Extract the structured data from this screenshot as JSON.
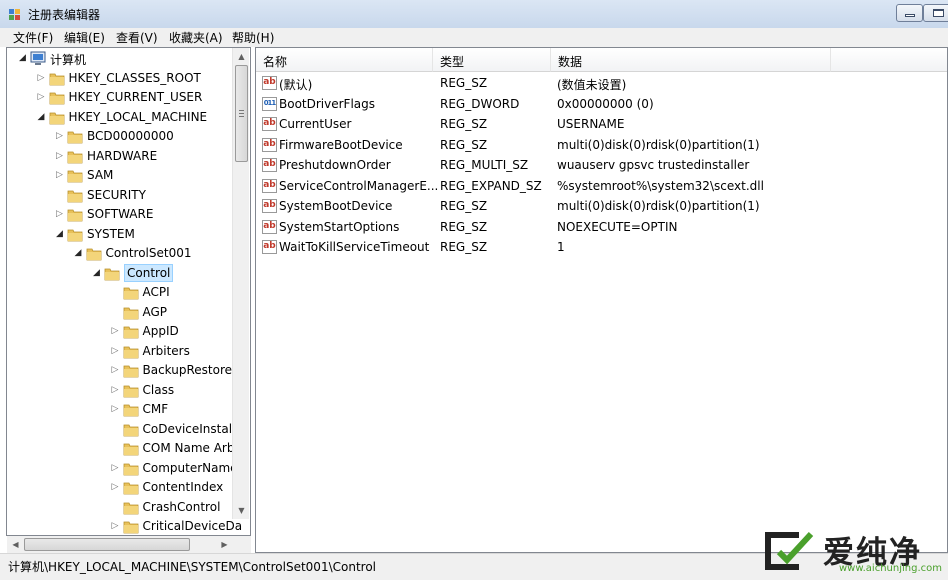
{
  "window": {
    "title": "注册表编辑器"
  },
  "menu": [
    "文件(F)",
    "编辑(E)",
    "查看(V)",
    "收藏夹(A)",
    "帮助(H)"
  ],
  "tree": [
    {
      "label": "计算机",
      "level": 0,
      "state": "open",
      "icon": "computer-icon"
    },
    {
      "label": "HKEY_CLASSES_ROOT",
      "level": 1,
      "state": "closed"
    },
    {
      "label": "HKEY_CURRENT_USER",
      "level": 1,
      "state": "closed"
    },
    {
      "label": "HKEY_LOCAL_MACHINE",
      "level": 1,
      "state": "open"
    },
    {
      "label": "BCD00000000",
      "level": 2,
      "state": "closed"
    },
    {
      "label": "HARDWARE",
      "level": 2,
      "state": "closed"
    },
    {
      "label": "SAM",
      "level": 2,
      "state": "closed"
    },
    {
      "label": "SECURITY",
      "level": 2,
      "state": "none"
    },
    {
      "label": "SOFTWARE",
      "level": 2,
      "state": "closed"
    },
    {
      "label": "SYSTEM",
      "level": 2,
      "state": "open"
    },
    {
      "label": "ControlSet001",
      "level": 3,
      "state": "open"
    },
    {
      "label": "Control",
      "level": 4,
      "state": "open",
      "selected": true
    },
    {
      "label": "ACPI",
      "level": 5,
      "state": "none"
    },
    {
      "label": "AGP",
      "level": 5,
      "state": "none"
    },
    {
      "label": "AppID",
      "level": 5,
      "state": "closed"
    },
    {
      "label": "Arbiters",
      "level": 5,
      "state": "closed"
    },
    {
      "label": "BackupRestore",
      "level": 5,
      "state": "closed"
    },
    {
      "label": "Class",
      "level": 5,
      "state": "closed"
    },
    {
      "label": "CMF",
      "level": 5,
      "state": "closed"
    },
    {
      "label": "CoDeviceInstalle",
      "level": 5,
      "state": "none"
    },
    {
      "label": "COM Name Arb",
      "level": 5,
      "state": "none"
    },
    {
      "label": "ComputerName",
      "level": 5,
      "state": "closed"
    },
    {
      "label": "ContentIndex",
      "level": 5,
      "state": "closed"
    },
    {
      "label": "CrashControl",
      "level": 5,
      "state": "none"
    },
    {
      "label": "CriticalDeviceDa",
      "level": 5,
      "state": "closed"
    }
  ],
  "columns": {
    "name": "名称",
    "type": "类型",
    "data": "数据"
  },
  "values": [
    {
      "name": "(默认)",
      "type": "REG_SZ",
      "data": "(数值未设置)",
      "icon": "sz"
    },
    {
      "name": "BootDriverFlags",
      "type": "REG_DWORD",
      "data": "0x00000000 (0)",
      "icon": "dw"
    },
    {
      "name": "CurrentUser",
      "type": "REG_SZ",
      "data": "USERNAME",
      "icon": "sz"
    },
    {
      "name": "FirmwareBootDevice",
      "type": "REG_SZ",
      "data": "multi(0)disk(0)rdisk(0)partition(1)",
      "icon": "sz"
    },
    {
      "name": "PreshutdownOrder",
      "type": "REG_MULTI_SZ",
      "data": "wuauserv gpsvc trustedinstaller",
      "icon": "sz"
    },
    {
      "name": "ServiceControlManagerE...",
      "type": "REG_EXPAND_SZ",
      "data": "%systemroot%\\system32\\scext.dll",
      "icon": "sz"
    },
    {
      "name": "SystemBootDevice",
      "type": "REG_SZ",
      "data": "multi(0)disk(0)rdisk(0)partition(1)",
      "icon": "sz"
    },
    {
      "name": "SystemStartOptions",
      "type": "REG_SZ",
      "data": " NOEXECUTE=OPTIN",
      "icon": "sz"
    },
    {
      "name": "WaitToKillServiceTimeout",
      "type": "REG_SZ",
      "data": "1",
      "icon": "sz"
    }
  ],
  "status": {
    "path": "计算机\\HKEY_LOCAL_MACHINE\\SYSTEM\\ControlSet001\\Control"
  },
  "watermark": {
    "main": "爱纯净",
    "sub": "www.aichunjing.com"
  },
  "colors": {
    "selection": "#cce8ff",
    "folder": "#e8c15a",
    "titlebar": "#c8d8ec",
    "watermark_green": "#4aa02c"
  },
  "icons": {
    "sz_text": "ab",
    "dword_text": "011"
  }
}
